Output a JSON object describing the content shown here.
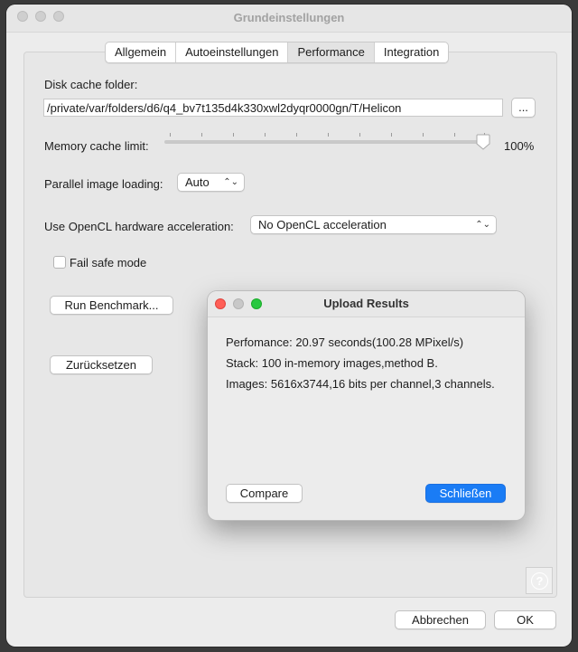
{
  "window": {
    "title": "Grundeinstellungen"
  },
  "tabs": [
    "Allgemein",
    "Autoeinstellungen",
    "Performance",
    "Integration"
  ],
  "active_tab": "Performance",
  "disk_cache": {
    "label": "Disk cache folder:",
    "value": "/private/var/folders/d6/q4_bv7t135d4k330xwl2dyqr0000gn/T/Helicon",
    "browse_label": "..."
  },
  "memory_cache": {
    "label": "Memory cache limit:",
    "value_text": "100%",
    "value": 100
  },
  "parallel_loading": {
    "label": "Parallel image loading:",
    "selected": "Auto"
  },
  "opencl": {
    "label": "Use OpenCL hardware acceleration:",
    "selected": "No OpenCL acceleration"
  },
  "fail_safe": {
    "label": "Fail safe mode",
    "checked": false
  },
  "buttons": {
    "run_benchmark": "Run Benchmark...",
    "reset": "Zurücksetzen",
    "cancel": "Abbrechen",
    "ok": "OK"
  },
  "help": {
    "icon": "question-icon",
    "glyph": "?"
  },
  "dialog": {
    "title": "Upload Results",
    "lines": [
      "Perfomance: 20.97 seconds(100.28 MPixel/s)",
      "Stack: 100 in-memory images,method B.",
      "Images: 5616x3744,16 bits per channel,3 channels."
    ],
    "compare_label": "Compare",
    "close_label": "Schließen"
  },
  "colors": {
    "accent": "#1a7cf5",
    "close_red": "#ff5f57",
    "minimize_yellow": "#c8c8c8",
    "zoom_green": "#28c840"
  }
}
